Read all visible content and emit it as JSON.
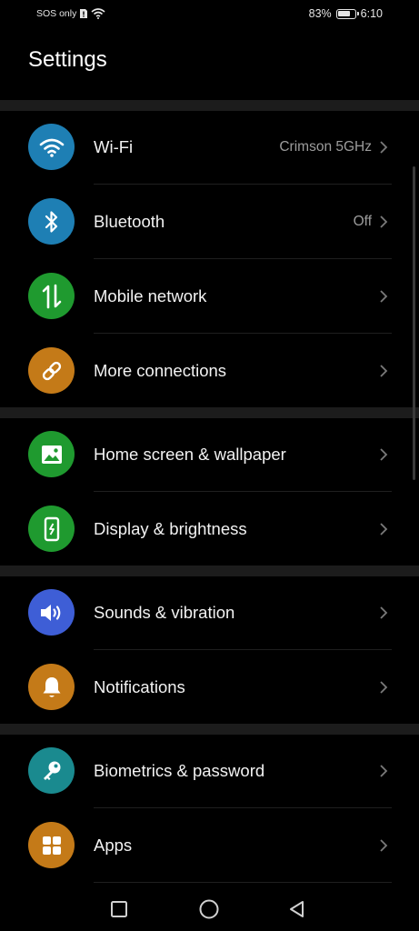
{
  "status_bar": {
    "carrier_text": "SOS only",
    "battery_level_percent": 83,
    "battery_text": "83%",
    "time": "6:10"
  },
  "header": {
    "title": "Settings"
  },
  "colors": {
    "wifi": "#1e7fb4",
    "bluetooth": "#1e7fb4",
    "mobile_network": "#1f9a2f",
    "more_connections": "#c47a18",
    "home_screen": "#1f9a2f",
    "display": "#1f9a2f",
    "sounds": "#3e5ed6",
    "notifications": "#c47a18",
    "biometrics": "#1a8a8f",
    "apps": "#c47a18"
  },
  "settings": {
    "wifi": {
      "label": "Wi-Fi",
      "value": "Crimson 5GHz",
      "icon": "wifi-icon"
    },
    "bluetooth": {
      "label": "Bluetooth",
      "value": "Off",
      "icon": "bluetooth-icon"
    },
    "mobile_network": {
      "label": "Mobile network",
      "icon": "mobile-data-icon"
    },
    "more_connections": {
      "label": "More connections",
      "icon": "link-icon"
    },
    "home_screen": {
      "label": "Home screen & wallpaper",
      "icon": "image-icon"
    },
    "display": {
      "label": "Display & brightness",
      "icon": "phone-brightness-icon"
    },
    "sounds": {
      "label": "Sounds & vibration",
      "icon": "speaker-icon"
    },
    "notifications": {
      "label": "Notifications",
      "icon": "bell-icon"
    },
    "biometrics": {
      "label": "Biometrics & password",
      "icon": "key-icon"
    },
    "apps": {
      "label": "Apps",
      "icon": "apps-grid-icon"
    }
  },
  "nav": {
    "recents": "recents-square-icon",
    "home": "home-circle-icon",
    "back": "back-triangle-icon"
  }
}
